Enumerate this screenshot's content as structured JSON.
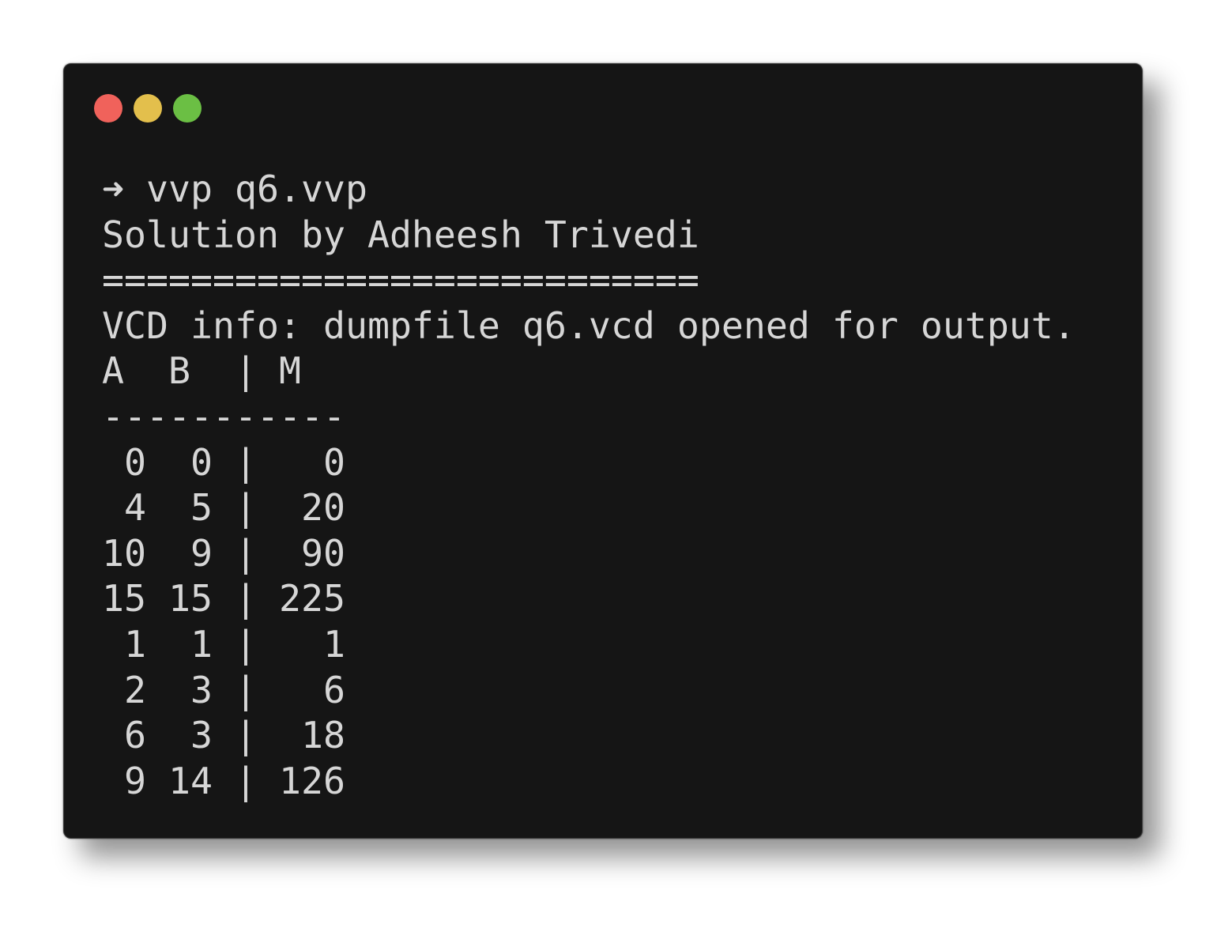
{
  "window": {
    "controls": [
      {
        "name": "close",
        "color": "#f0625b"
      },
      {
        "name": "minimize",
        "color": "#e3bf4c"
      },
      {
        "name": "maximize",
        "color": "#6bbf44"
      }
    ],
    "background": "#151515",
    "text_color": "#d6d6d6"
  },
  "terminal": {
    "prompt_symbol": "➜",
    "command": "vvp q6.vvp",
    "lines": [
      "Solution by Adheesh Trivedi",
      "===========================",
      "VCD info: dumpfile q6.vcd opened for output.",
      "A  B  | M",
      "-----------",
      " 0  0 |   0",
      " 4  5 |  20",
      "10  9 |  90",
      "15 15 | 225",
      " 1  1 |   1",
      " 2  3 |   6",
      " 6  3 |  18",
      " 9 14 | 126"
    ]
  }
}
